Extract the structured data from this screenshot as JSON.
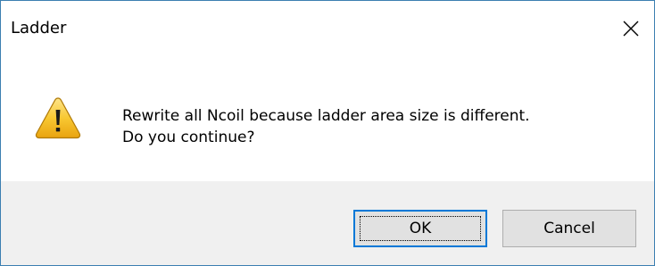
{
  "window": {
    "title": "Ladder",
    "close_icon": "close-icon"
  },
  "message": {
    "icon": "warning-icon",
    "line1": "Rewrite all Ncoil because ladder area size is different.",
    "line2": "Do you continue?"
  },
  "buttons": {
    "ok_label": "OK",
    "cancel_label": "Cancel"
  },
  "colors": {
    "border": "#3c7fb1",
    "button_bar": "#f0f0f0",
    "button_face": "#e1e1e1",
    "focus_border": "#0078d7",
    "warning_fill": "#f5c518"
  }
}
